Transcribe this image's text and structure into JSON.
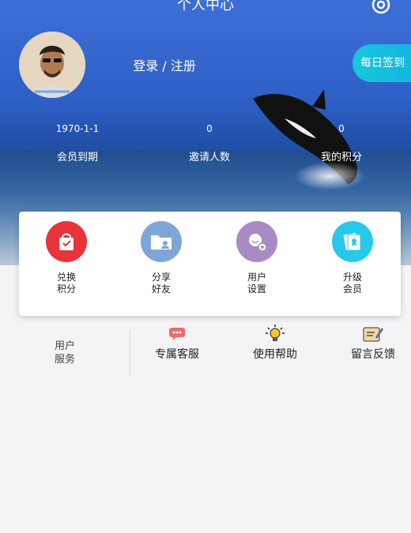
{
  "header": {
    "title": "个人中心",
    "settings_icon": "gear-icon"
  },
  "profile": {
    "login_text": "登录 / 注册",
    "daily_signin_label": "每日签到"
  },
  "stats": [
    {
      "value": "1970-1-1",
      "label": "会员到期"
    },
    {
      "value": "0",
      "label": "邀请人数"
    },
    {
      "value": "0",
      "label": "我的积分"
    }
  ],
  "actions": [
    {
      "label": "兑换\n积分",
      "icon": "shopping-bag-icon",
      "color": "#e8333a"
    },
    {
      "label": "分享\n好友",
      "icon": "share-folder-icon",
      "color": "#7fa6d8"
    },
    {
      "label": "用户\n设置",
      "icon": "user-settings-icon",
      "color": "#a98bc3"
    },
    {
      "label": "升级\n会员",
      "icon": "member-card-icon",
      "color": "#27c9ea"
    }
  ],
  "service": {
    "title": "用户\n服务",
    "items": [
      {
        "label": "专属客服",
        "icon": "chat-bubble-icon"
      },
      {
        "label": "使用帮助",
        "icon": "lightbulb-icon"
      },
      {
        "label": "留言反馈",
        "icon": "feedback-edit-icon"
      }
    ]
  }
}
